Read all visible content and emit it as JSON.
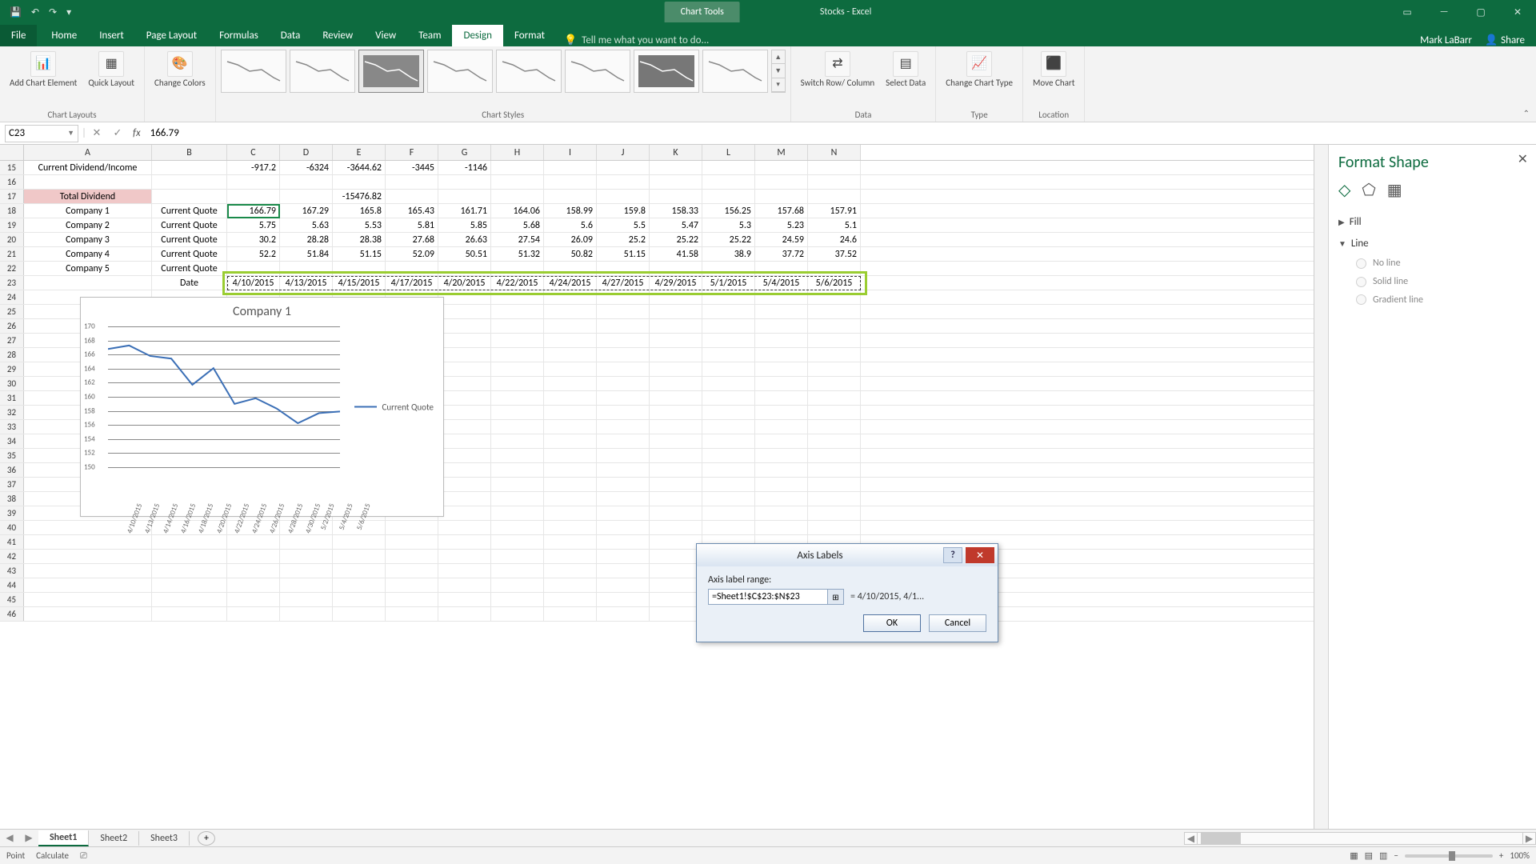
{
  "app": {
    "qat": {
      "save": "💾",
      "undo": "↶",
      "redo": "↷",
      "more": "▾"
    },
    "context_tab": "Chart Tools",
    "title": "Stocks - Excel",
    "win": {
      "opts": "▭",
      "min": "—",
      "max": "▢",
      "close": "✕"
    }
  },
  "tabs": {
    "file": "File",
    "home": "Home",
    "insert": "Insert",
    "page_layout": "Page Layout",
    "formulas": "Formulas",
    "data": "Data",
    "review": "Review",
    "view": "View",
    "team": "Team",
    "design": "Design",
    "format": "Format",
    "tellme": "Tell me what you want to do...",
    "user": "Mark LaBarr",
    "share": "Share"
  },
  "ribbon": {
    "layouts_group": "Chart Layouts",
    "styles_group": "Chart Styles",
    "data_group": "Data",
    "type_group": "Type",
    "location_group": "Location",
    "add_chart": "Add Chart Element",
    "quick_layout": "Quick Layout",
    "change_colors": "Change Colors",
    "switch": "Switch Row/ Column",
    "select_data": "Select Data",
    "change_type": "Change Chart Type",
    "move": "Move Chart"
  },
  "formula_bar": {
    "name": "C23",
    "fx": "fx",
    "value": "166.79"
  },
  "cols": {
    "A": "A",
    "B": "B",
    "C": "C",
    "D": "D",
    "E": "E",
    "F": "F",
    "G": "G",
    "H": "H",
    "I": "I",
    "J": "J",
    "K": "K",
    "L": "L",
    "M": "M",
    "N": "N"
  },
  "rows": {
    "15": {
      "A": "Current Dividend/Income",
      "C": "-917.2",
      "D": "-6324",
      "E": "-3644.62",
      "F": "-3445",
      "G": "-1146"
    },
    "16": {},
    "17": {
      "A": "Total Dividend",
      "E": "-15476.82"
    },
    "18": {
      "A": "Company 1",
      "B": "Current Quote",
      "C": "166.79",
      "D": "167.29",
      "E": "165.8",
      "F": "165.43",
      "G": "161.71",
      "H": "164.06",
      "I": "158.99",
      "J": "159.8",
      "K": "158.33",
      "L": "156.25",
      "M": "157.68",
      "N": "157.91"
    },
    "19": {
      "A": "Company 2",
      "B": "Current Quote",
      "C": "5.75",
      "D": "5.63",
      "E": "5.53",
      "F": "5.81",
      "G": "5.85",
      "H": "5.68",
      "I": "5.6",
      "J": "5.5",
      "K": "5.47",
      "L": "5.3",
      "M": "5.23",
      "N": "5.1"
    },
    "20": {
      "A": "Company 3",
      "B": "Current Quote",
      "C": "30.2",
      "D": "28.28",
      "E": "28.38",
      "F": "27.68",
      "G": "26.63",
      "H": "27.54",
      "I": "26.09",
      "J": "25.2",
      "K": "25.22",
      "L": "25.22",
      "M": "24.59",
      "N": "24.6"
    },
    "21": {
      "A": "Company 4",
      "B": "Current Quote",
      "C": "52.2",
      "D": "51.84",
      "E": "51.15",
      "F": "52.09",
      "G": "50.51",
      "H": "51.32",
      "I": "50.82",
      "J": "51.15",
      "K": "41.58",
      "L": "38.9",
      "M": "37.72",
      "N": "37.52"
    },
    "22": {
      "A": "Company 5",
      "B": "Current Quote"
    },
    "23": {
      "B": "Date",
      "C": "4/10/2015",
      "D": "4/13/2015",
      "E": "4/15/2015",
      "F": "4/17/2015",
      "G": "4/20/2015",
      "H": "4/22/2015",
      "I": "4/24/2015",
      "J": "4/27/2015",
      "K": "4/29/2015",
      "L": "5/1/2015",
      "M": "5/4/2015",
      "N": "5/6/2015"
    }
  },
  "chart_data": {
    "type": "line",
    "title": "Company 1",
    "series": [
      {
        "name": "Current Quote",
        "values": [
          166.79,
          167.29,
          165.8,
          165.43,
          161.71,
          164.06,
          158.99,
          159.8,
          158.33,
          156.25,
          157.68,
          157.91
        ]
      }
    ],
    "categories": [
      "4/10/2015",
      "4/13/2015",
      "4/14/2015",
      "4/16/2015",
      "4/18/2015",
      "4/20/2015",
      "4/22/2015",
      "4/24/2015",
      "4/26/2015",
      "4/28/2015",
      "4/30/2015",
      "5/2/2015",
      "5/4/2015",
      "5/6/2015"
    ],
    "yticks": [
      150,
      152,
      154,
      156,
      158,
      160,
      162,
      164,
      166,
      168,
      170
    ],
    "ylim": [
      150,
      170
    ],
    "legend_position": "right"
  },
  "format_pane": {
    "title": "Format Shape",
    "close": "✕",
    "sections": {
      "fill": "Fill",
      "line": "Line"
    },
    "line_opts": {
      "none": "No line",
      "solid": "Solid line",
      "gradient": "Gradient line"
    }
  },
  "dialog": {
    "title": "Axis Labels",
    "label": "Axis label range:",
    "range": "=Sheet1!$C$23:$N$23",
    "preview": "= 4/10/2015, 4/1...",
    "ok": "OK",
    "cancel": "Cancel",
    "help": "?",
    "close": "✕",
    "picker": "⊞"
  },
  "sheets": {
    "sheet1": "Sheet1",
    "sheet2": "Sheet2",
    "sheet3": "Sheet3",
    "add": "+"
  },
  "status": {
    "mode": "Point",
    "calc": "Calculate",
    "rec": "⎚",
    "zoom": "100%",
    "plus": "+",
    "minus": "−"
  }
}
